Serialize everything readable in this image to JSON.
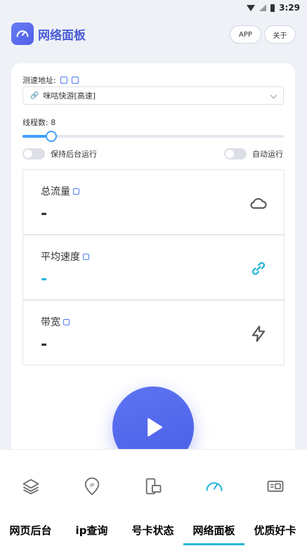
{
  "status_bar": {
    "time": "3:29"
  },
  "header": {
    "title": "网络面板",
    "app_button": "APP",
    "about_button": "关于"
  },
  "speed_test": {
    "url_label": "测速地址:",
    "url_value": "咪咕快游[高速]",
    "threads_label": "线程数:",
    "threads_value": "8",
    "threads_fraction": 0.11,
    "keep_background_label": "保持后台运行",
    "auto_run_label": "自动运行"
  },
  "stats": [
    {
      "label": "总流量",
      "value": "-",
      "icon": "cloud-icon"
    },
    {
      "label": "平均速度",
      "value": "-",
      "icon": "link-icon"
    },
    {
      "label": "带宽",
      "value": "-",
      "icon": "lightning-icon"
    }
  ],
  "tabs": [
    {
      "label": "网页后台",
      "icon": "layers-icon",
      "active": false
    },
    {
      "label": "ip查询",
      "icon": "ip-pin-icon",
      "active": false
    },
    {
      "label": "号卡状态",
      "icon": "card-status-icon",
      "active": false
    },
    {
      "label": "网络面板",
      "icon": "speedometer-icon",
      "active": true
    },
    {
      "label": "优质好卡",
      "icon": "sim-card-icon",
      "active": false
    }
  ],
  "colors": {
    "accent": "#4a5fe6",
    "cyan": "#27b6d6",
    "slider": "#409eff"
  }
}
